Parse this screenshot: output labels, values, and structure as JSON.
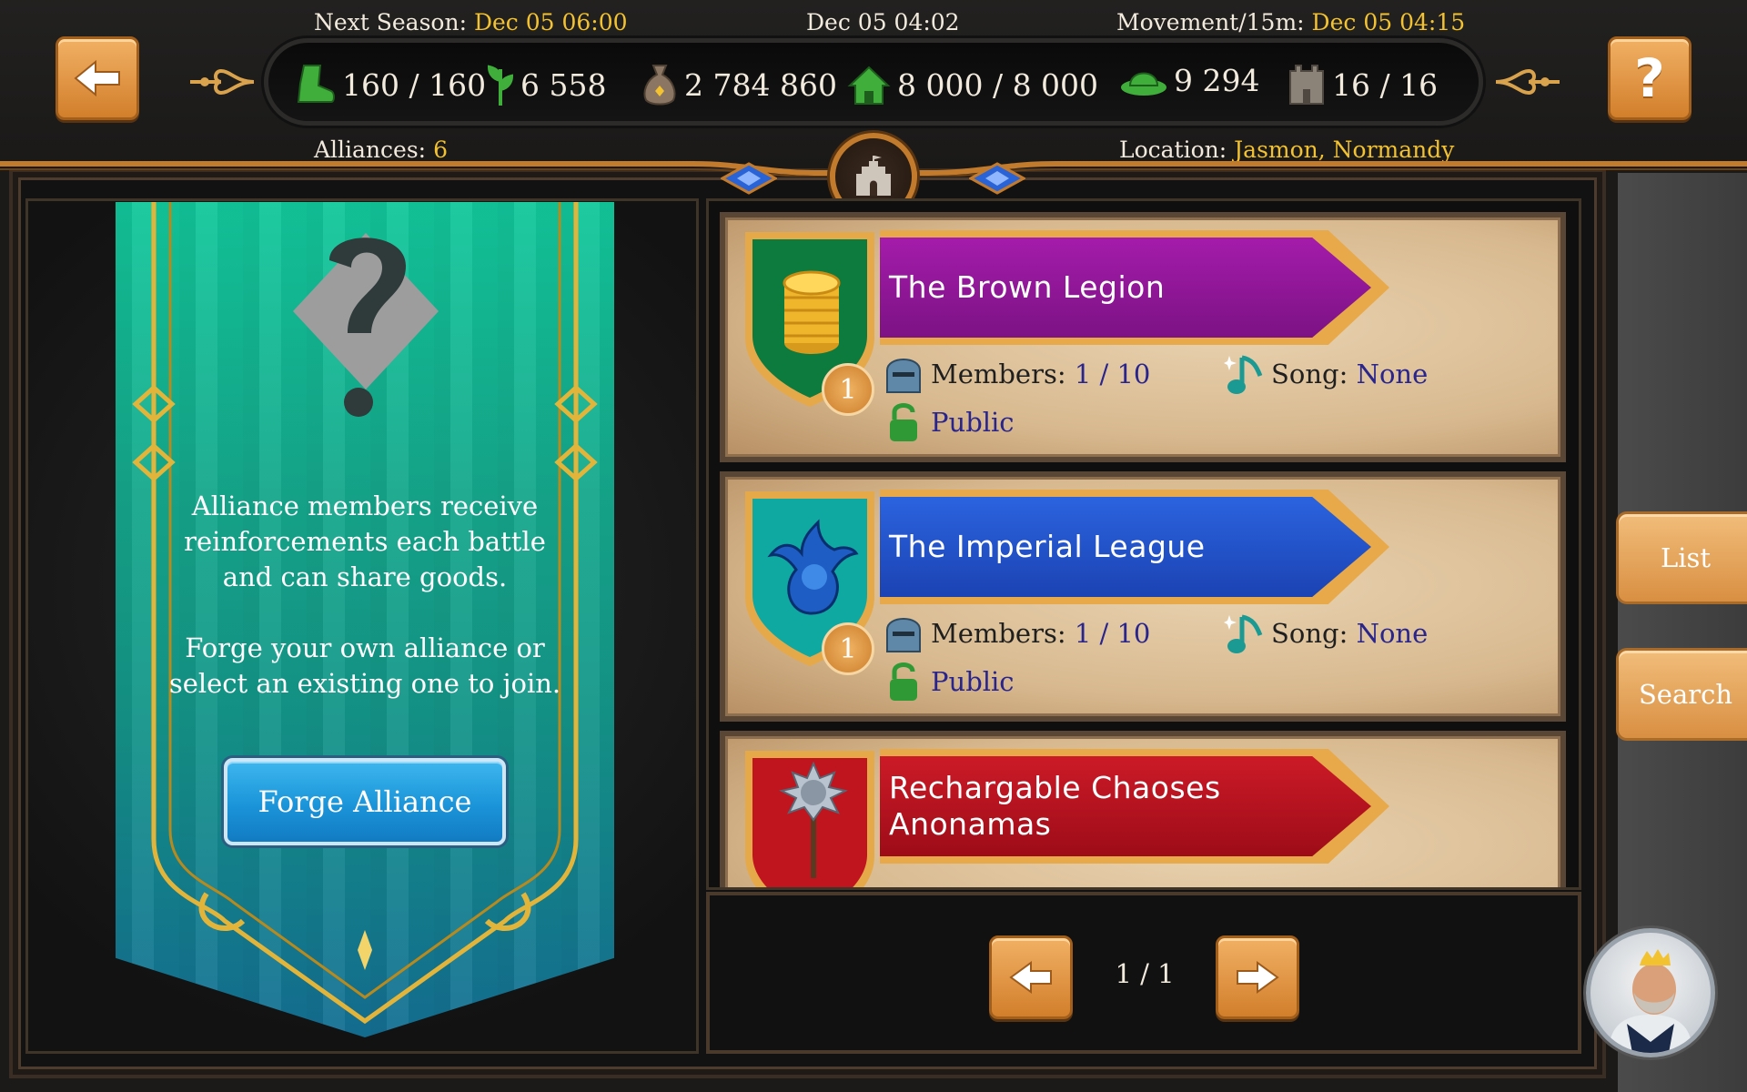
{
  "header": {
    "next_season_label": "Next Season:",
    "next_season_value": "Dec 05 06:00",
    "current_time": "Dec 05 04:02",
    "movement_label": "Movement/15m:",
    "movement_value": "Dec 05 04:15",
    "alliances_label": "Alliances:",
    "alliances_value": "6",
    "location_label": "Location:",
    "location_value": "Jasmon, Normandy"
  },
  "resources": [
    {
      "icon": "boot-icon",
      "value": "160 / 160"
    },
    {
      "icon": "leaf-icon",
      "value": "6 558"
    },
    {
      "icon": "coin-bag-icon",
      "value": "2 784 860"
    },
    {
      "icon": "house-icon",
      "value": "8 000 / 8 000"
    },
    {
      "icon": "hat-icon",
      "value": "9 294"
    },
    {
      "icon": "castle-icon",
      "value": "16 / 16"
    }
  ],
  "info_banner": {
    "text1": "Alliance members receive reinforcements each battle and can share goods.",
    "text2": "Forge your own alliance or select an existing one to join.",
    "forge_button": "Forge Alliance"
  },
  "alliances": [
    {
      "name": "The Brown Legion",
      "rank": "1",
      "members_label": "Members:",
      "members_value": "1 / 10",
      "song_label": "Song:",
      "song_value": "None",
      "access": "Public",
      "ribbon_color": "#8b1593",
      "shield_color": "#0d7a3e",
      "emblem": "gold-coins-icon"
    },
    {
      "name": "The Imperial League",
      "rank": "1",
      "members_label": "Members:",
      "members_value": "1 / 10",
      "song_label": "Song:",
      "song_value": "None",
      "access": "Public",
      "ribbon_color": "#1f4fc9",
      "shield_color": "#0fa9a2",
      "emblem": "dragon-icon"
    },
    {
      "name": "Rechargable Chaoses Anonamas",
      "ribbon_color": "#b5101c",
      "shield_color": "#c0141f",
      "emblem": "mace-icon"
    }
  ],
  "pager": {
    "label": "1 / 1"
  },
  "side_tabs": {
    "list": "List",
    "search": "Search"
  },
  "colors": {
    "accent_gold": "#f2c230",
    "button_orange": "#d98f42",
    "link_blue": "#2a258c"
  }
}
